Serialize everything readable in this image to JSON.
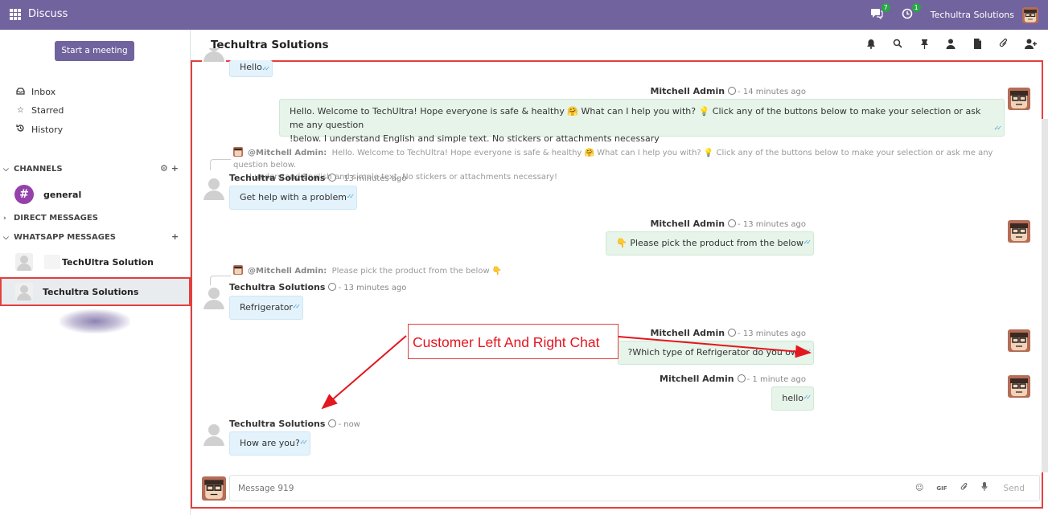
{
  "topbar": {
    "app_name": "Discuss",
    "messages_badge": "7",
    "activity_badge": "1",
    "company": "Techultra Solutions"
  },
  "sidebar": {
    "start_meeting": "Start a meeting",
    "nav": [
      {
        "label": "Inbox",
        "icon": "inbox-icon"
      },
      {
        "label": "Starred",
        "icon": "star-icon"
      },
      {
        "label": "History",
        "icon": "history-icon"
      }
    ],
    "channels_header": "CHANNELS",
    "channels": [
      {
        "name": "general"
      }
    ],
    "direct_messages_header": "DIRECT MESSAGES",
    "whatsapp_header": "WHATSAPP MESSAGES",
    "whatsapp_items": [
      {
        "name": "TechUltra Solution"
      },
      {
        "name": "Techultra Solutions"
      }
    ]
  },
  "thread": {
    "title": "Techultra Solutions",
    "messages": {
      "m0": {
        "text": "Hello"
      },
      "m1": {
        "author": "Mitchell Admin",
        "time": "- 14 minutes ago",
        "line1": "Hello. Welcome to TechUltra! Hope everyone is safe & healthy 🤗 What can I help you with? 💡 Click any of the buttons below to make your selection or ask me any question",
        "line2": "!below. I understand English and simple text. No stickers or attachments necessary"
      },
      "r1": {
        "who": "@Mitchell Admin:",
        "line1": "Hello. Welcome to TechUltra! Hope everyone is safe & healthy 🤗 What can I help you with? 💡 Click any of the buttons below to make your selection or ask me any question below.",
        "line2": "I understand English and simple text. No stickers or attachments necessary!"
      },
      "m2": {
        "author": "Techultra Solutions",
        "time": "- 13 minutes ago",
        "text": "Get help with a problem"
      },
      "m3": {
        "author": "Mitchell Admin",
        "time": "- 13 minutes ago",
        "text": "👇 Please pick the product from the below"
      },
      "r2": {
        "who": "@Mitchell Admin:",
        "text": "Please pick the product from the below 👇"
      },
      "m4": {
        "author": "Techultra Solutions",
        "time": "- 13 minutes ago",
        "text": "Refrigerator"
      },
      "m5": {
        "author": "Mitchell Admin",
        "time": "- 13 minutes ago",
        "text": "?Which type of Refrigerator do you own"
      },
      "m6": {
        "author": "Mitchell Admin",
        "time": "- 1 minute ago",
        "text": "hello"
      },
      "m7": {
        "author": "Techultra Solutions",
        "time": "- now",
        "text": "How are you?"
      }
    }
  },
  "annotation": {
    "text": "Customer Left And Right Chat"
  },
  "composer": {
    "placeholder": "Message 919",
    "gif": "GIF",
    "send": "Send"
  },
  "colors": {
    "brand": "#71639e",
    "annotation": "#e4161f",
    "left_bubble": "#e3f2fb",
    "right_bubble": "#e6f4e9"
  }
}
